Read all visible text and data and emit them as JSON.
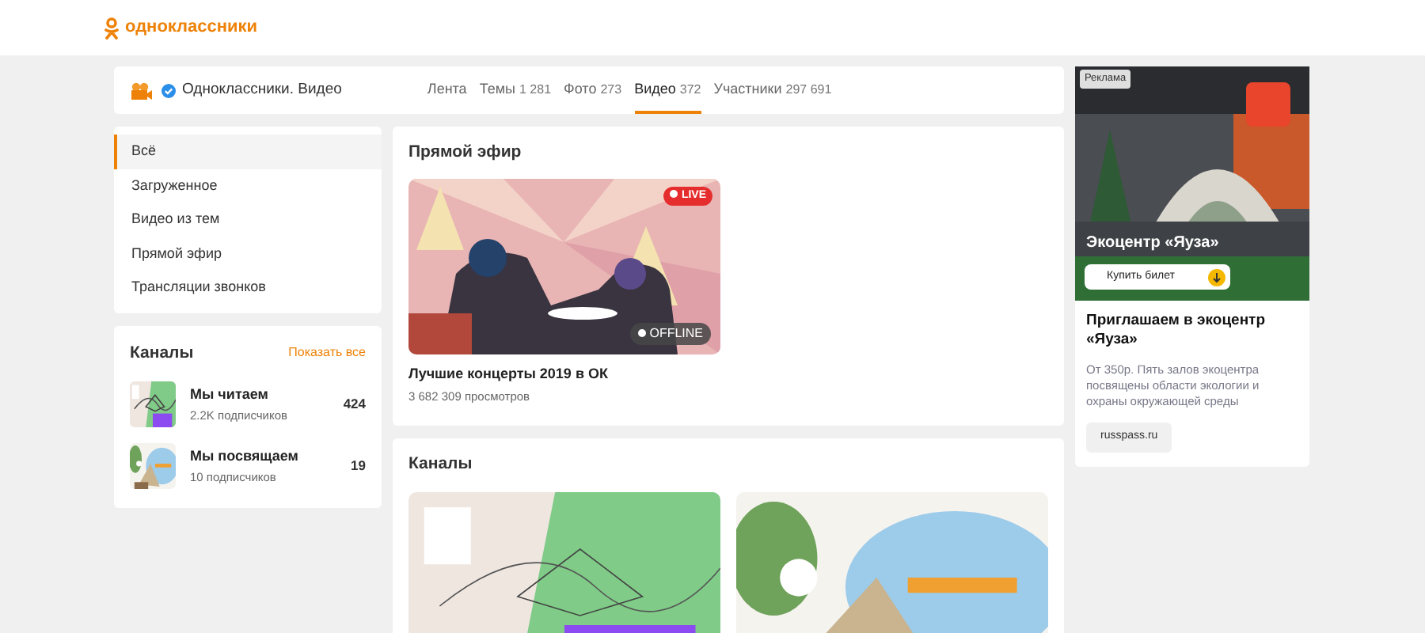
{
  "header": {
    "logo_text": "одноклассники"
  },
  "group": {
    "name": "Одноклассники. Видео",
    "verified": true,
    "tabs": [
      {
        "label": "Лента",
        "selected": false
      },
      {
        "label": "Темы",
        "count": "1 281",
        "selected": false
      },
      {
        "label": "Фото",
        "count": "273",
        "selected": false
      },
      {
        "label": "Видео",
        "count": "372",
        "selected": true
      },
      {
        "label": "Участники",
        "count": "297 691",
        "selected": false
      }
    ]
  },
  "sidebar": {
    "items": [
      {
        "label": "Всё",
        "selected": true
      },
      {
        "label": "Загруженное",
        "selected": false
      },
      {
        "label": "Видео из тем",
        "selected": false
      },
      {
        "label": "Прямой эфир",
        "selected": false
      },
      {
        "label": "Трансляции звонков",
        "selected": false
      }
    ],
    "channels": {
      "title": "Каналы",
      "show_all": "Показать все",
      "items": [
        {
          "name": "Мы читаем",
          "subscribers": "2.2K подписчиков",
          "count": "424"
        },
        {
          "name": "Мы посвящаем",
          "subscribers": "10 подписчиков",
          "count": "19"
        }
      ]
    }
  },
  "live": {
    "title": "Прямой эфир",
    "video": {
      "badge": "LIVE",
      "status": "OFFLINE",
      "title": "Лучшие концерты 2019 в ОК",
      "views": "3 682 309 просмотров"
    }
  },
  "channels_section": {
    "title": "Каналы"
  },
  "ad": {
    "label": "Реклама",
    "overlay_title": "Экоцентр «Яуза»",
    "button": "Купить билет",
    "title": "Приглашаем в экоцентр «Яуза»",
    "description": "От 350р. Пять залов экоцентра посвящены области экологии и охраны окружающей среды",
    "link": "russpass.ru"
  }
}
